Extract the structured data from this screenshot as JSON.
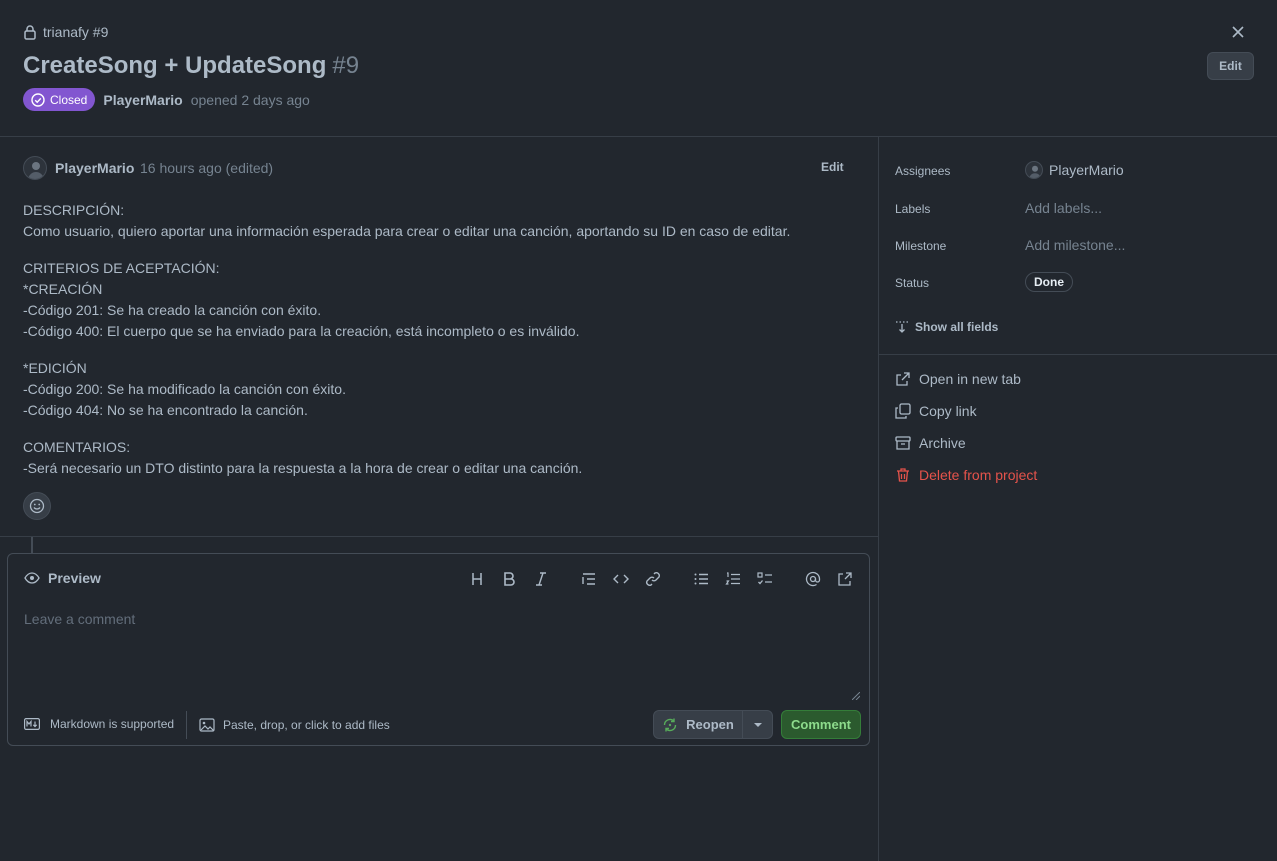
{
  "header": {
    "repo": "trianafy #9",
    "title": "CreateSong + UpdateSong",
    "number": "#9",
    "status_badge": "Closed",
    "author": "PlayerMario",
    "opened_text": "opened 2 days ago",
    "edit_label": "Edit"
  },
  "comment": {
    "author": "PlayerMario",
    "time": "16 hours ago (edited)",
    "edit_label": "Edit",
    "lines": [
      "DESCRIPCIÓN:",
      "Como usuario, quiero aportar una información esperada para crear o editar una canción, aportando su ID en caso de editar.",
      "",
      "CRITERIOS DE ACEPTACIÓN:",
      "*CREACIÓN",
      "-Código 201: Se ha creado la canción con éxito.",
      "-Código 400: El cuerpo que se ha enviado para la creación, está incompleto o es inválido.",
      "",
      "*EDICIÓN",
      "-Código 200: Se ha modificado la canción con éxito.",
      "-Código 404: No se ha encontrado la canción.",
      "",
      "COMENTARIOS:",
      "-Será necesario un DTO distinto para la respuesta a la hora de crear o editar una canción."
    ]
  },
  "composer": {
    "preview_label": "Preview",
    "placeholder": "Leave a comment",
    "markdown_label": "Markdown is supported",
    "files_label": "Paste, drop, or click to add files",
    "reopen_label": "Reopen",
    "comment_label": "Comment"
  },
  "sidebar": {
    "assignees_label": "Assignees",
    "assignee": "PlayerMario",
    "labels_label": "Labels",
    "labels_value": "Add labels...",
    "milestone_label": "Milestone",
    "milestone_value": "Add milestone...",
    "status_label": "Status",
    "status_value": "Done",
    "show_all": "Show all fields",
    "actions": {
      "open_new_tab": "Open in new tab",
      "copy_link": "Copy link",
      "archive": "Archive",
      "delete": "Delete from project"
    }
  },
  "colors": {
    "background": "#22272e",
    "closed_badge": "#8256d0",
    "danger": "#e5534b",
    "comment_button": "#2b5a2e"
  }
}
